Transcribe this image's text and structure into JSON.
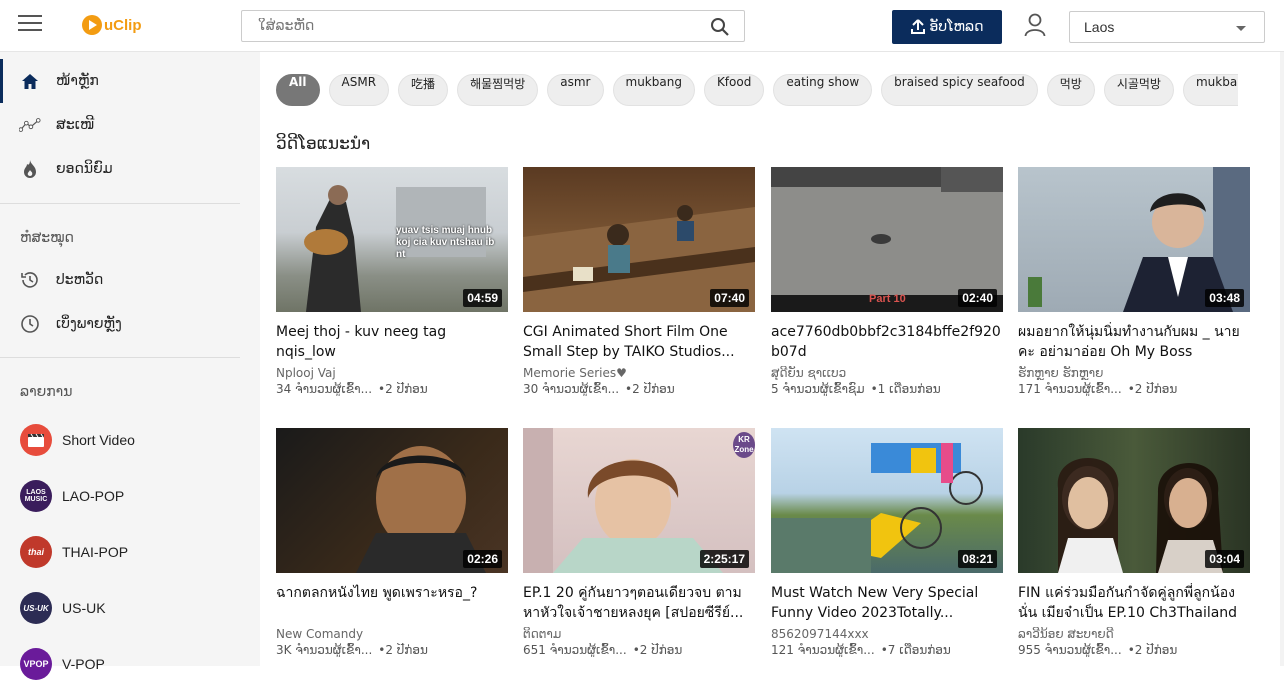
{
  "header": {
    "logo_text": "uClip",
    "search_placeholder": "ໃສ່ລະຫັດ",
    "upload_label": "ອັບໂຫລດ",
    "country": "Laos",
    "accent_color": "#0b2c5c",
    "logo_color": "#f39c12"
  },
  "sidebar": {
    "nav": [
      {
        "label": "ໜ້າຫຼັກ",
        "icon": "home-icon"
      },
      {
        "label": "ສະເໜີ",
        "icon": "trending-graph-icon"
      },
      {
        "label": "ຍອດນິຍົມ",
        "icon": "flame-icon"
      }
    ],
    "library_title": "ຫໍສະໝຸດ",
    "library": [
      {
        "label": "ປະຫວັດ",
        "icon": "history-icon"
      },
      {
        "label": "ເບິ່ງພາຍຫຼັງ",
        "icon": "clock-icon"
      }
    ],
    "channels_title": "ລາຍການ",
    "channels": [
      {
        "label": "Short Video",
        "avatar_text": "",
        "color": "#e74c3c"
      },
      {
        "label": "LAO-POP",
        "avatar_text": "LAOS MUSIC",
        "color": "#5a2d82"
      },
      {
        "label": "THAI-POP",
        "avatar_text": "thai",
        "color": "#d35400"
      },
      {
        "label": "US-UK",
        "avatar_text": "US-UK",
        "color": "#2c2c54"
      },
      {
        "label": "V-POP",
        "avatar_text": "VPOP",
        "color": "#6a1b9a"
      }
    ]
  },
  "chips": [
    "All",
    "ASMR",
    "吃播",
    "해물찜먹방",
    "asmr",
    "mukbang",
    "Kfood",
    "eating show",
    "braised spicy seafood",
    "먹방",
    "시골먹방",
    "mukbang korea"
  ],
  "section_title": "ວິດີໂອແນະນຳ",
  "videos": [
    {
      "title": "Meej thoj - kuv neeg tag nqis_low",
      "channel": "Nplooj Vaj",
      "views": "34 ຈຳນວນຜູ້ເຂົ້າ...",
      "date": "•2 ປີກ່ອນ",
      "duration": "04:59"
    },
    {
      "title": "CGI Animated Short Film One Small Step by TAIKO Studios...",
      "channel": "Memorie Series♥",
      "views": "30 ຈຳນວນຜູ້ເຂົ້າ...",
      "date": "•2 ປີກ່ອນ",
      "duration": "07:40"
    },
    {
      "title": "ace7760db0bbf2c3184bffe2f920 b07d",
      "channel": "ສຸດີຍັນ ຊາເເບວ",
      "views": "5 ຈຳນວນຜູ້ເຂົ້າຊົມ",
      "date": "•1 ເດືອນກ່ອນ",
      "duration": "02:40"
    },
    {
      "title": "ผมอยากให้นุ่มนิ่มทำงานกับผม _ นายคะ อย่ามาอ่อย Oh My Boss",
      "channel": "ຮັກຫຼາຍ ຮັກຫຼາຍ",
      "views": "171 ຈຳນວນຜູ້ເຂົ້າ...",
      "date": "•2 ປີກ່ອນ",
      "duration": "03:48"
    },
    {
      "title": "ฉากตลกหนังไทย พูดเพราะหรอ_?",
      "channel": "New Comandy",
      "views": "3K ຈຳນວນຜູ້ເຂົ້າ...",
      "date": "•2 ປີກ່ອນ",
      "duration": "02:26"
    },
    {
      "title": "EP.1 20 คู่กันยาวๆตอนเดียวจบ ตามหาหัวใจเจ้าชายหลงยุค [สปอยซีรีย์...",
      "channel": "ຕິດຕາມ",
      "views": "651 ຈຳນວນຜູ້ເຂົ້າ...",
      "date": "•2 ປີກ່ອນ",
      "duration": "2:25:17"
    },
    {
      "title": "Must Watch New Very Special Funny Video 2023Totally...",
      "channel": "8562097144xxx",
      "views": "121 ຈຳນວນຜູ້ເຂົ້າ...",
      "date": "•7 ເດືອນກ່ອນ",
      "duration": "08:21"
    },
    {
      "title": "FIN แค่ร่วมมือกันกำจัดคู่ลูกพี่ลูกน้อง นั่น เมียจ๋าเป็น EP.10 Ch3Thailand",
      "channel": "ລາວີນ້ອຍ ສະບາຍດີ",
      "views": "955 ຈຳນວນຜູ້ເຂົ້າ...",
      "date": "•2 ປີກ່ອນ",
      "duration": "03:04"
    }
  ],
  "thumb_overlays": {
    "v0": "yuav tsis muaj hnub koj cia kuv ntshau ib nt",
    "v2": "Part 10",
    "v5": "KR Zone"
  }
}
